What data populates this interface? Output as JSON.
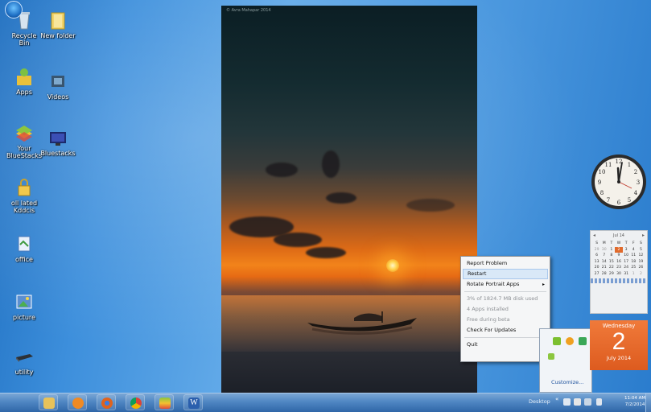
{
  "desktop_icons": [
    {
      "name": "recycle-bin",
      "label": "Recycle Bin",
      "icon": "recycle-bin-icon"
    },
    {
      "name": "new-folder",
      "label": "New folder",
      "icon": "folder-icon"
    },
    {
      "name": "apps",
      "label": "Apps",
      "icon": "apps-icon"
    },
    {
      "name": "videos",
      "label": "Videos",
      "icon": "video-icon"
    },
    {
      "name": "your-bluestacks",
      "label": "Your BlueStacks",
      "icon": "bluestacks-icon"
    },
    {
      "name": "bluestacks",
      "label": "Bluestacks",
      "icon": "monitor-icon"
    },
    {
      "name": "protected-folder",
      "label": "oll lated Kddcis",
      "icon": "lock-icon"
    },
    {
      "name": "office",
      "label": "office",
      "icon": "office-icon"
    },
    {
      "name": "pictures",
      "label": "picture",
      "icon": "pictures-icon"
    },
    {
      "name": "utility",
      "label": "utility",
      "icon": "drive-icon"
    }
  ],
  "wallpaper": {
    "credit": "© Avra Mahapar 2014"
  },
  "context_menu": {
    "items": [
      {
        "label": "Report Problem",
        "state": "normal"
      },
      {
        "label": "Restart",
        "state": "selected"
      },
      {
        "label": "Rotate Portrait Apps",
        "state": "normal",
        "submenu": true
      },
      {
        "label": "3% of 1824.7 MB disk used",
        "state": "disabled"
      },
      {
        "label": "4 Apps installed",
        "state": "disabled"
      },
      {
        "label": "Free during beta",
        "state": "disabled"
      },
      {
        "label": "Check For Updates",
        "state": "normal"
      },
      {
        "label": "Quit",
        "state": "normal"
      }
    ],
    "submenu_arrow": "▸"
  },
  "tray_popup": {
    "customize_label": "Customize..."
  },
  "calendar_gadget": {
    "month_year": "Jul 14",
    "weekdays": [
      "S",
      "M",
      "T",
      "W",
      "T",
      "F",
      "S"
    ],
    "days": [
      "29",
      "30",
      "1",
      "2",
      "3",
      "4",
      "5",
      "6",
      "7",
      "8",
      "9",
      "10",
      "11",
      "12",
      "13",
      "14",
      "15",
      "16",
      "17",
      "18",
      "19",
      "20",
      "21",
      "22",
      "23",
      "24",
      "25",
      "26",
      "27",
      "28",
      "29",
      "30",
      "31",
      "1",
      "2"
    ],
    "today": "2",
    "prev": "◂",
    "next": "▸"
  },
  "date_gadget": {
    "weekday": "Wednesday",
    "day": "2",
    "month_year": "July 2014"
  },
  "clock_gadget": {
    "time": "11:04"
  },
  "taskbar": {
    "desktop_label": "Desktop",
    "tray_arrow": "«",
    "time": "11:04 AM",
    "date": "7/2/2014",
    "pinned": [
      {
        "name": "explorer",
        "color": "#e8c25a"
      },
      {
        "name": "media-player",
        "color": "#f08a24"
      },
      {
        "name": "firefox",
        "color": "#e0631d"
      },
      {
        "name": "chrome",
        "color": "#3aa757"
      },
      {
        "name": "bluestacks",
        "color": "#7bbf2f"
      },
      {
        "name": "word",
        "color": "#2b5fad"
      }
    ],
    "word_letter": "W"
  }
}
